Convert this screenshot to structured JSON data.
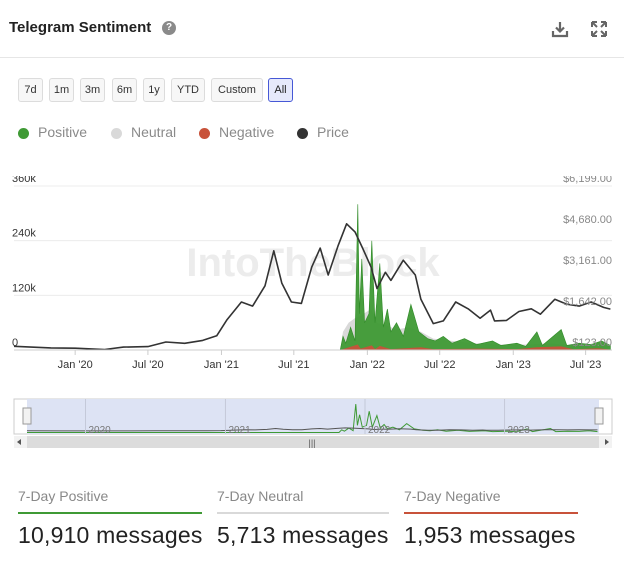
{
  "header": {
    "title": "Telegram Sentiment",
    "help_icon": "question-circle-icon",
    "download_icon": "download-icon",
    "expand_icon": "fullscreen-icon"
  },
  "range_buttons": [
    {
      "label": "7d",
      "active": false
    },
    {
      "label": "1m",
      "active": false
    },
    {
      "label": "3m",
      "active": false
    },
    {
      "label": "6m",
      "active": false
    },
    {
      "label": "1y",
      "active": false
    },
    {
      "label": "YTD",
      "active": false
    },
    {
      "label": "Custom",
      "active": false
    },
    {
      "label": "All",
      "active": true
    }
  ],
  "legend": [
    {
      "label": "Positive",
      "color": "#3f9a35"
    },
    {
      "label": "Neutral",
      "color": "#d9d9d9"
    },
    {
      "label": "Negative",
      "color": "#c8523a"
    },
    {
      "label": "Price",
      "color": "#333333"
    }
  ],
  "watermark": "IntoTheBlock",
  "chart_data": {
    "type": "area",
    "title": "Telegram Sentiment",
    "x_ticks": [
      "Jan '20",
      "Jul '20",
      "Jan '21",
      "Jul '21",
      "Jan '22",
      "Jul '22",
      "Jan '23",
      "Jul '23"
    ],
    "y_left_ticks": [
      "0",
      "120k",
      "240k",
      "360k"
    ],
    "y_left_range": [
      0,
      360000
    ],
    "y_right_ticks": [
      "$123.00",
      "$1,642.00",
      "$3,161.00",
      "$4,680.00",
      "$6,199.00"
    ],
    "y_right_range": [
      123,
      6199
    ],
    "grid": true,
    "legend_position": "top-left",
    "series": [
      {
        "name": "Price",
        "axis": "right",
        "color": "#333333",
        "points": [
          [
            "2019-08-01",
            260
          ],
          [
            "2019-11-01",
            200
          ],
          [
            "2020-01-01",
            190
          ],
          [
            "2020-03-15",
            140
          ],
          [
            "2020-05-01",
            230
          ],
          [
            "2020-07-01",
            250
          ],
          [
            "2020-08-15",
            420
          ],
          [
            "2020-10-01",
            370
          ],
          [
            "2020-11-15",
            480
          ],
          [
            "2020-12-20",
            650
          ],
          [
            "2021-01-15",
            1250
          ],
          [
            "2021-02-20",
            1900
          ],
          [
            "2021-03-20",
            1750
          ],
          [
            "2021-04-20",
            2500
          ],
          [
            "2021-05-12",
            3800
          ],
          [
            "2021-06-01",
            2600
          ],
          [
            "2021-06-25",
            1900
          ],
          [
            "2021-07-20",
            1850
          ],
          [
            "2021-08-15",
            3200
          ],
          [
            "2021-09-05",
            3900
          ],
          [
            "2021-09-25",
            2900
          ],
          [
            "2021-10-20",
            4000
          ],
          [
            "2021-11-10",
            4800
          ],
          [
            "2021-12-01",
            4500
          ],
          [
            "2021-12-20",
            3900
          ],
          [
            "2022-01-10",
            3200
          ],
          [
            "2022-01-25",
            2400
          ],
          [
            "2022-02-15",
            3000
          ],
          [
            "2022-03-01",
            2700
          ],
          [
            "2022-04-01",
            3450
          ],
          [
            "2022-05-01",
            2900
          ],
          [
            "2022-05-15",
            2000
          ],
          [
            "2022-06-15",
            1100
          ],
          [
            "2022-07-10",
            1200
          ],
          [
            "2022-08-10",
            1900
          ],
          [
            "2022-09-10",
            1650
          ],
          [
            "2022-10-10",
            1300
          ],
          [
            "2022-11-05",
            1600
          ],
          [
            "2022-11-15",
            1200
          ],
          [
            "2022-12-15",
            1220
          ],
          [
            "2023-01-15",
            1550
          ],
          [
            "2023-02-15",
            1650
          ],
          [
            "2023-03-10",
            1450
          ],
          [
            "2023-04-15",
            2000
          ],
          [
            "2023-05-15",
            1820
          ],
          [
            "2023-06-15",
            1750
          ],
          [
            "2023-07-15",
            1900
          ],
          [
            "2023-08-15",
            1700
          ],
          [
            "2023-09-01",
            1640
          ]
        ]
      },
      {
        "name": "Neutral",
        "axis": "left",
        "color": "#d9d9d9",
        "points": [
          [
            "2019-08-01",
            0
          ],
          [
            "2021-10-25",
            0
          ],
          [
            "2021-11-01",
            40000
          ],
          [
            "2021-11-15",
            60000
          ],
          [
            "2021-12-01",
            70000
          ],
          [
            "2021-12-15",
            75000
          ],
          [
            "2022-01-10",
            90000
          ],
          [
            "2022-01-25",
            60000
          ],
          [
            "2022-02-15",
            55000
          ],
          [
            "2022-03-15",
            45000
          ],
          [
            "2022-04-15",
            50000
          ],
          [
            "2022-05-15",
            40000
          ],
          [
            "2022-06-15",
            25000
          ],
          [
            "2022-08-01",
            20000
          ],
          [
            "2022-10-01",
            15000
          ],
          [
            "2022-12-01",
            12000
          ],
          [
            "2023-02-01",
            12000
          ],
          [
            "2023-04-01",
            15000
          ],
          [
            "2023-06-01",
            10000
          ],
          [
            "2023-09-01",
            10000
          ]
        ]
      },
      {
        "name": "Positive",
        "axis": "left",
        "color": "#3f9a35",
        "points": [
          [
            "2019-08-01",
            0
          ],
          [
            "2021-10-25",
            0
          ],
          [
            "2021-11-01",
            30000
          ],
          [
            "2021-11-08",
            15000
          ],
          [
            "2021-11-20",
            50000
          ],
          [
            "2021-12-01",
            20000
          ],
          [
            "2021-12-08",
            320000
          ],
          [
            "2021-12-12",
            80000
          ],
          [
            "2021-12-18",
            200000
          ],
          [
            "2021-12-25",
            60000
          ],
          [
            "2022-01-05",
            80000
          ],
          [
            "2022-01-12",
            240000
          ],
          [
            "2022-01-20",
            60000
          ],
          [
            "2022-02-01",
            190000
          ],
          [
            "2022-02-10",
            50000
          ],
          [
            "2022-02-20",
            90000
          ],
          [
            "2022-03-01",
            40000
          ],
          [
            "2022-03-15",
            60000
          ],
          [
            "2022-04-01",
            30000
          ],
          [
            "2022-04-20",
            100000
          ],
          [
            "2022-05-10",
            40000
          ],
          [
            "2022-06-01",
            25000
          ],
          [
            "2022-06-20",
            20000
          ],
          [
            "2022-07-10",
            30000
          ],
          [
            "2022-08-01",
            15000
          ],
          [
            "2022-09-01",
            25000
          ],
          [
            "2022-10-01",
            12000
          ],
          [
            "2022-11-10",
            20000
          ],
          [
            "2022-12-01",
            10000
          ],
          [
            "2023-01-10",
            15000
          ],
          [
            "2023-02-01",
            8000
          ],
          [
            "2023-03-01",
            40000
          ],
          [
            "2023-03-15",
            10000
          ],
          [
            "2023-05-01",
            45000
          ],
          [
            "2023-05-15",
            10000
          ],
          [
            "2023-06-15",
            15000
          ],
          [
            "2023-07-15",
            12000
          ],
          [
            "2023-08-10",
            20000
          ],
          [
            "2023-09-01",
            10000
          ]
        ]
      },
      {
        "name": "Negative",
        "axis": "left",
        "color": "#c8523a",
        "points": [
          [
            "2019-08-01",
            0
          ],
          [
            "2021-10-25",
            0
          ],
          [
            "2021-12-08",
            12000
          ],
          [
            "2021-12-15",
            3000
          ],
          [
            "2022-01-12",
            10000
          ],
          [
            "2022-01-20",
            2000
          ],
          [
            "2022-02-01",
            9000
          ],
          [
            "2022-03-01",
            2000
          ],
          [
            "2022-05-15",
            6000
          ],
          [
            "2022-06-15",
            2000
          ],
          [
            "2022-10-01",
            3000
          ],
          [
            "2023-01-10",
            2000
          ],
          [
            "2023-03-01",
            6000
          ],
          [
            "2023-05-01",
            8000
          ],
          [
            "2023-06-01",
            1500
          ],
          [
            "2023-08-01",
            4000
          ],
          [
            "2023-09-01",
            1000
          ]
        ]
      }
    ]
  },
  "navigator": {
    "year_labels": [
      "2020",
      "2021",
      "2022",
      "2023"
    ],
    "scrollbar_grip": "|||"
  },
  "stats": [
    {
      "label": "7-Day Positive",
      "value": "10,910 messages",
      "color": "#3f9a35"
    },
    {
      "label": "7-Day Neutral",
      "value": "5,713 messages",
      "color": "#d9d9d9"
    },
    {
      "label": "7-Day Negative",
      "value": "1,953 messages",
      "color": "#c8523a"
    }
  ]
}
